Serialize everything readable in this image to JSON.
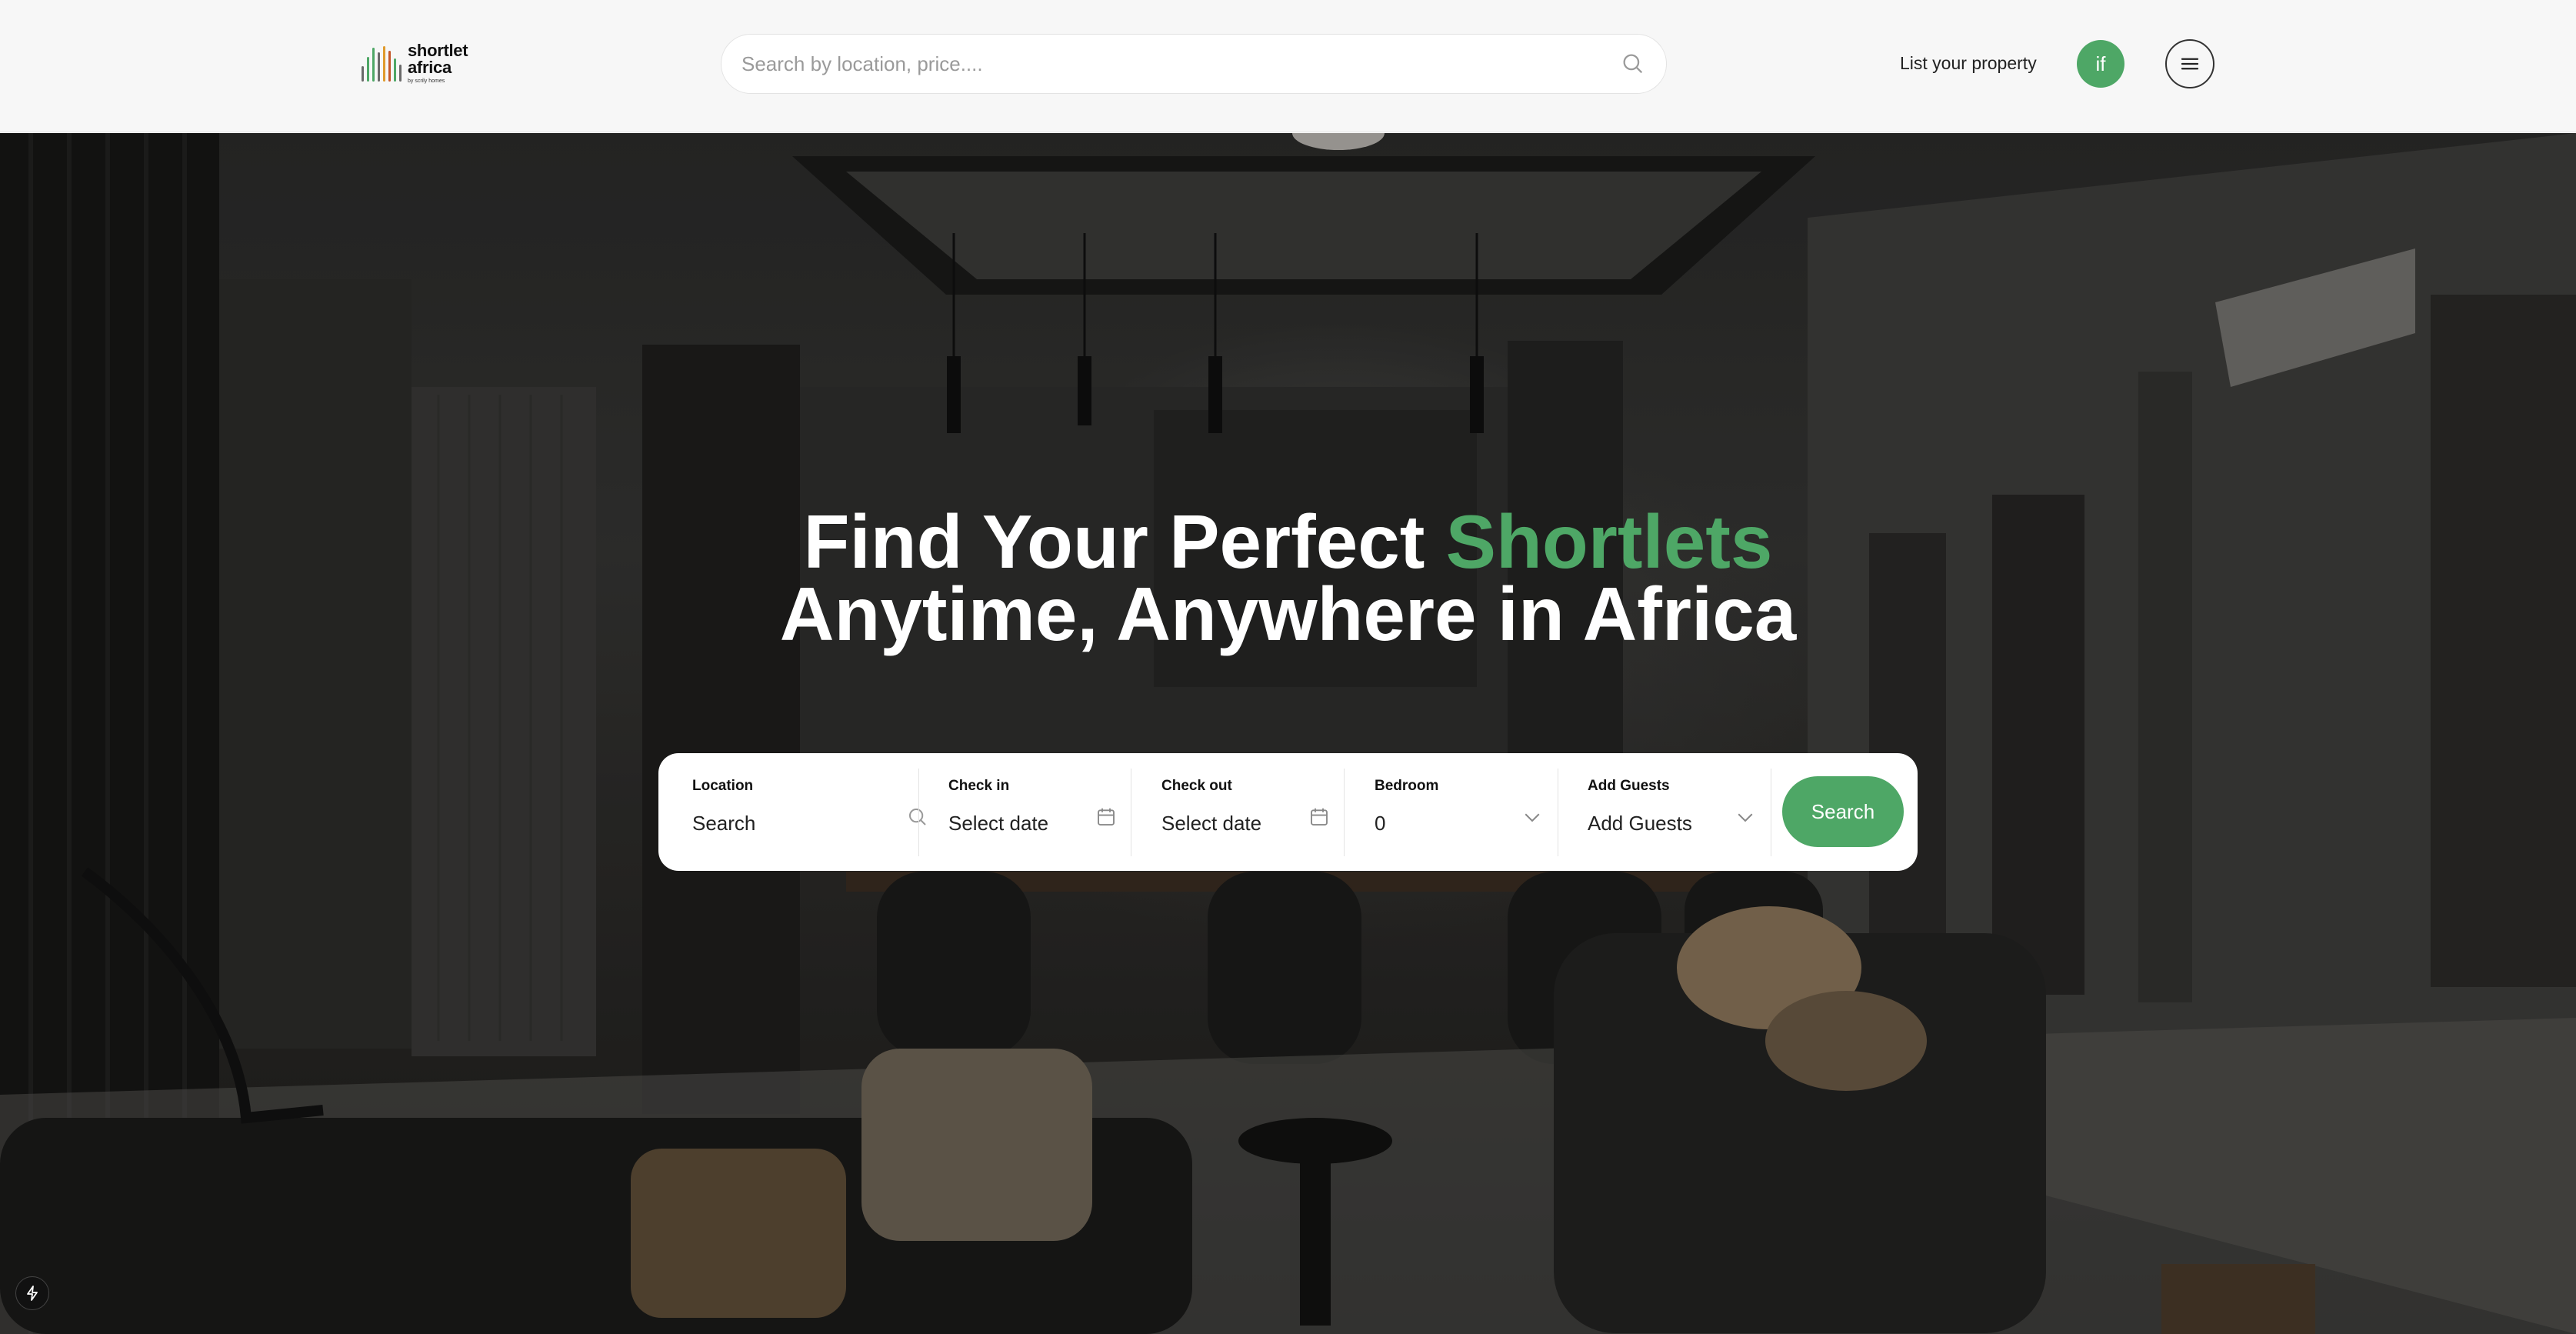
{
  "header": {
    "logo": {
      "line1": "shortlet",
      "line2": "africa",
      "line3": "by scrily homes"
    },
    "search_placeholder": "Search by location, price....",
    "list_property_label": "List your property",
    "avatar_initials": "if"
  },
  "hero": {
    "title_prefix": "Find Your Perfect",
    "title_accent": "Shortlets",
    "title_line2": "Anytime, Anywhere in Africa"
  },
  "booking": {
    "location": {
      "label": "Location",
      "value": "Search"
    },
    "check_in": {
      "label": "Check in",
      "value": "Select date"
    },
    "check_out": {
      "label": "Check out",
      "value": "Select date"
    },
    "bedroom": {
      "label": "Bedroom",
      "value": "0"
    },
    "guests": {
      "label": "Add Guests",
      "value": "Add Guests"
    },
    "search_button": "Search"
  },
  "colors": {
    "accent": "#4ea766",
    "header_bg": "#f7f7f7",
    "logo_bars": [
      "#6a6a6a",
      "#4ea766",
      "#e09a2c",
      "#c4582a"
    ]
  },
  "icons": [
    "search-icon",
    "hamburger-menu-icon",
    "calendar-icon",
    "chevron-down-icon",
    "bolt-icon"
  ]
}
